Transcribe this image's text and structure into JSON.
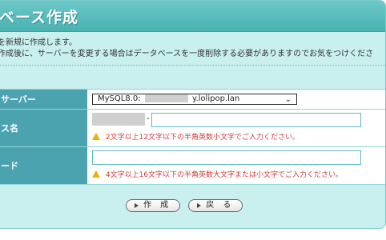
{
  "title": "ベース作成",
  "description_lines": [
    "を新規に作成します。",
    "作成後に、サーバーを変更する場合はデータベースを一度削除する必要がありますのでお気をつけくださ"
  ],
  "form": {
    "server_label": "サーバー",
    "server_select": {
      "value_prefix": "MySQL8.0:",
      "value_suffix": "y.lolipop.lan"
    },
    "db_name_label": "ス名",
    "db_name_note": "2文字以上12文字以下の半角英数小文字でご入力ください。",
    "password_label": "ード",
    "password_note": "4文字以上16文字以下の半角英数大文字または小文字でご入力ください。"
  },
  "buttons": {
    "create_label": "作 成",
    "back_label": "戻 る"
  },
  "colors": {
    "panel_bg": "#c9efef",
    "title_bar": "#4ab1b1",
    "label_bg": "#4ba3b0",
    "warning_text": "#d23a3a"
  }
}
